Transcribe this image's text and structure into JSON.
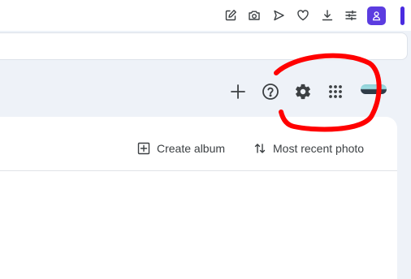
{
  "browser_toolbar": {
    "icons": [
      "edit-icon",
      "camera-icon",
      "send-icon",
      "heart-icon",
      "download-icon",
      "tune-icon"
    ],
    "profile_icon": "person-icon"
  },
  "app_header": {
    "icons": [
      "add-icon",
      "help-icon",
      "settings-icon",
      "apps-grid-icon"
    ]
  },
  "panel_toolbar": {
    "create_album_label": "Create album",
    "sort_label": "Most recent photo"
  },
  "colors": {
    "accent": "#5b3ce0",
    "annotation": "#ff0000",
    "background": "#eef2f8"
  }
}
